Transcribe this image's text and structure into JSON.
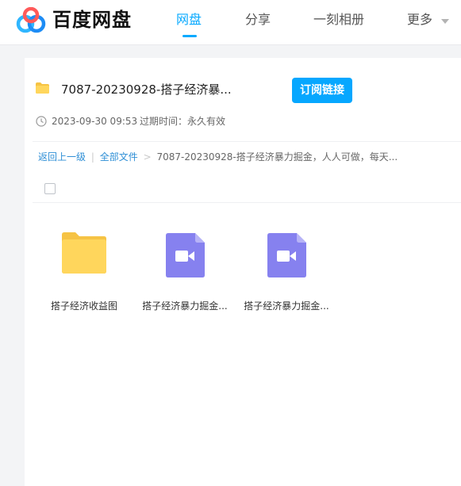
{
  "header": {
    "brand": "百度网盘",
    "nav": [
      {
        "label": "网盘"
      },
      {
        "label": "分享"
      },
      {
        "label": "一刻相册"
      },
      {
        "label": "更多"
      }
    ]
  },
  "share": {
    "title": "7087-20230928-搭子经济暴...",
    "subscribe_label": "订阅链接",
    "date": "2023-09-30 09:53",
    "expire": "过期时间：永久有效"
  },
  "breadcrumb": {
    "back": "返回上一级",
    "divider": "|",
    "all": "全部文件",
    "arrow": ">",
    "current": "7087-20230928-搭子经济暴力掘金，人人可做，每天..."
  },
  "files": [
    {
      "name": "搭子经济收益图",
      "type": "folder"
    },
    {
      "name": "搭子经济暴力掘金...",
      "type": "video"
    },
    {
      "name": "搭子经济暴力掘金...",
      "type": "video"
    }
  ],
  "colors": {
    "accent": "#06a7ff",
    "folder": "#ffd65c",
    "video": "#8681ef"
  }
}
